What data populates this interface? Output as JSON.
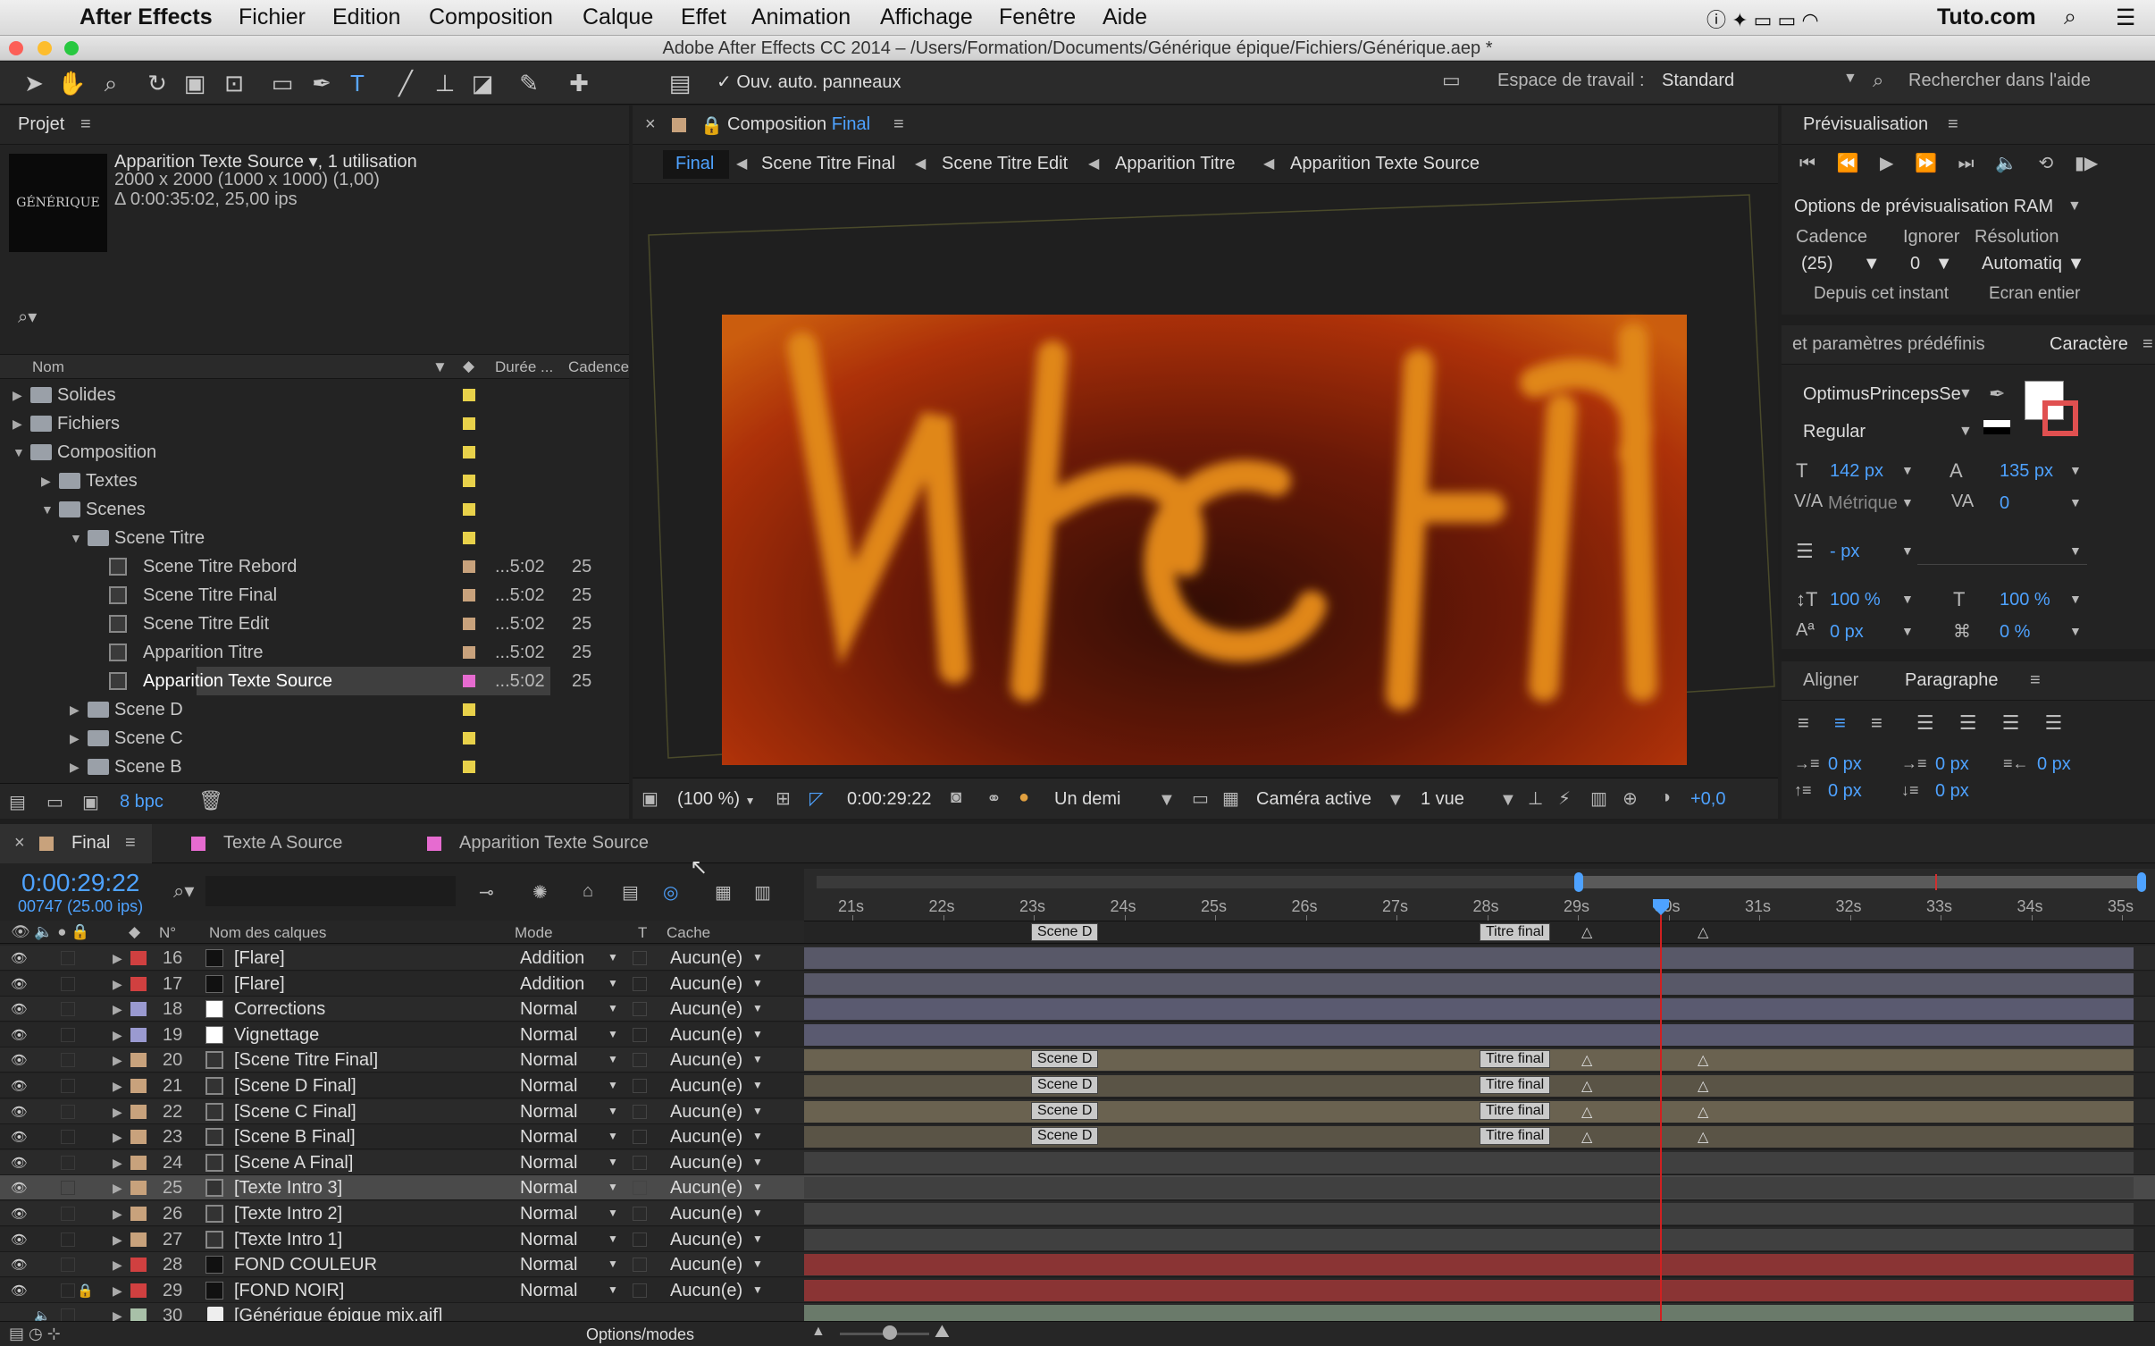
{
  "menubar": {
    "app": "After Effects",
    "items": [
      "Fichier",
      "Edition",
      "Composition",
      "Calque",
      "Effet",
      "Animation",
      "Affichage",
      "Fenêtre",
      "Aide"
    ],
    "right": "Tuto.com"
  },
  "window_title": "Adobe After Effects CC 2014 – /Users/Formation/Documents/Générique épique/Fichiers/Générique.aep *",
  "toolbar": {
    "auto_panels": "Ouv. auto. panneaux",
    "workspace_label": "Espace de travail :",
    "workspace_value": "Standard",
    "help_search": "Rechercher dans l'aide"
  },
  "project": {
    "tab": "Projet",
    "thumb_text": "GÉNÉRIQUE",
    "item_name": "Apparition Texte Source ▾",
    "item_usage": ", 1 utilisation",
    "item_size": "2000 x 2000  (1000 x 1000) (1,00)",
    "item_duration": "Δ 0:00:35:02, 25,00 ips",
    "col_name": "Nom",
    "col_duration": "Durée ...",
    "col_rate": "Cadence",
    "bpc": "8 bpc",
    "items": [
      {
        "name": "Solides",
        "indent": 0,
        "type": "folder",
        "open": false,
        "label_color": "#e8d14a",
        "dur": "",
        "rate": ""
      },
      {
        "name": "Fichiers",
        "indent": 0,
        "type": "folder",
        "open": false,
        "label_color": "#e8d14a",
        "dur": "",
        "rate": ""
      },
      {
        "name": "Composition",
        "indent": 0,
        "type": "folder",
        "open": true,
        "label_color": "#e8d14a",
        "dur": "",
        "rate": ""
      },
      {
        "name": "Textes",
        "indent": 1,
        "type": "folder",
        "open": false,
        "label_color": "#e8d14a",
        "dur": "",
        "rate": ""
      },
      {
        "name": "Scenes",
        "indent": 1,
        "type": "folder",
        "open": true,
        "label_color": "#e8d14a",
        "dur": "",
        "rate": ""
      },
      {
        "name": "Scene Titre",
        "indent": 2,
        "type": "folder",
        "open": true,
        "label_color": "#e8d14a",
        "dur": "",
        "rate": ""
      },
      {
        "name": "Scene Titre Rebord",
        "indent": 3,
        "type": "comp",
        "open": false,
        "label_color": "#c8a27c",
        "dur": "...5:02",
        "rate": "25"
      },
      {
        "name": "Scene Titre Final",
        "indent": 3,
        "type": "comp",
        "open": false,
        "label_color": "#c8a27c",
        "dur": "...5:02",
        "rate": "25"
      },
      {
        "name": "Scene Titre Edit",
        "indent": 3,
        "type": "comp",
        "open": false,
        "label_color": "#c8a27c",
        "dur": "...5:02",
        "rate": "25"
      },
      {
        "name": "Apparition Titre",
        "indent": 3,
        "type": "comp",
        "open": false,
        "label_color": "#c8a27c",
        "dur": "...5:02",
        "rate": "25"
      },
      {
        "name": "Apparition Texte Source",
        "indent": 3,
        "type": "comp",
        "open": false,
        "label_color": "#e66bd0",
        "dur": "...5:02",
        "rate": "25",
        "selected": true
      },
      {
        "name": "Scene D",
        "indent": 2,
        "type": "folder",
        "open": false,
        "label_color": "#e8d14a",
        "dur": "",
        "rate": ""
      },
      {
        "name": "Scene C",
        "indent": 2,
        "type": "folder",
        "open": false,
        "label_color": "#e8d14a",
        "dur": "",
        "rate": ""
      },
      {
        "name": "Scene B",
        "indent": 2,
        "type": "folder",
        "open": false,
        "label_color": "#e8d14a",
        "dur": "",
        "rate": ""
      }
    ]
  },
  "composition": {
    "tab_label": "Composition",
    "tab_name": "Final",
    "breadcrumbs": [
      "Final",
      "Scene Titre Final",
      "Scene Titre Edit",
      "Apparition Titre",
      "Apparition Texte Source"
    ],
    "zoom": "(100 %)",
    "timecode": "0:00:29:22",
    "resolution": "Un demi",
    "camera": "Caméra active",
    "views": "1 vue",
    "exposure": "+0,0"
  },
  "preview": {
    "tab": "Prévisualisation",
    "ram_options": "Options de prévisualisation RAM",
    "cadence_label": "Cadence",
    "ignore_label": "Ignorer",
    "resolution_label": "Résolution",
    "cadence_value": "(25)",
    "ignore_value": "0",
    "resolution_value": "Automatiq",
    "from_now": "Depuis cet instant",
    "fullscreen": "Ecran entier"
  },
  "character": {
    "tab_presets": "et paramètres prédéfinis",
    "tab": "Caractère",
    "font": "OptimusPrincepsSe",
    "style": "Regular",
    "size": "142 px",
    "leading": "135 px",
    "kerning": "Métrique",
    "tracking": "0",
    "stroke": "- px",
    "vscale": "100 %",
    "hscale": "100 %",
    "baseline": "0 px",
    "tsume": "0 %"
  },
  "paragraph": {
    "tab_align": "Aligner",
    "tab": "Paragraphe",
    "indent_left": "0 px",
    "indent_first": "0 px",
    "indent_right": "0 px",
    "space_before": "0 px",
    "space_after": "0 px"
  },
  "timeline": {
    "tabs": [
      {
        "name": "Final",
        "color": "#c8a27c",
        "active": true
      },
      {
        "name": "Texte A Source",
        "color": "#e66bd0"
      },
      {
        "name": "Apparition Texte Source",
        "color": "#e66bd0"
      }
    ],
    "timecode": "0:00:29:22",
    "frames": "00747 (25.00 ips)",
    "col_num": "N°",
    "col_name": "Nom des calques",
    "col_mode": "Mode",
    "col_t": "T",
    "col_cache": "Cache",
    "options_modes": "Options/modes",
    "ruler": [
      "21s",
      "22s",
      "23s",
      "24s",
      "25s",
      "26s",
      "27s",
      "28s",
      "29s",
      "30s",
      "31s",
      "32s",
      "33s",
      "34s",
      "35s"
    ],
    "top_markers": [
      "Scene D",
      "Titre final"
    ],
    "layers": [
      {
        "num": "16",
        "name": "[Flare]",
        "label": "#d04040",
        "swatch": "#111",
        "mode": "Addition",
        "cache": "Aucun(e)",
        "bar": "#585868",
        "eye": true
      },
      {
        "num": "17",
        "name": "[Flare]",
        "label": "#d04040",
        "swatch": "#111",
        "mode": "Addition",
        "cache": "Aucun(e)",
        "bar": "#585868",
        "eye": true
      },
      {
        "num": "18",
        "name": "Corrections",
        "label": "#9a9ad0",
        "swatch": "#fff",
        "mode": "Normal",
        "cache": "Aucun(e)",
        "bar": "#5a5a70",
        "eye": true
      },
      {
        "num": "19",
        "name": "Vignettage",
        "label": "#9a9ad0",
        "swatch": "#fff",
        "mode": "Normal",
        "cache": "Aucun(e)",
        "bar": "#5a5a70",
        "eye": true
      },
      {
        "num": "20",
        "name": "[Scene Titre Final]",
        "label": "#c8a27c",
        "swatch": "comp",
        "mode": "Normal",
        "cache": "Aucun(e)",
        "bar": "#6a6250",
        "eye": true,
        "markers": true
      },
      {
        "num": "21",
        "name": "[Scene D Final]",
        "label": "#c8a27c",
        "swatch": "comp",
        "mode": "Normal",
        "cache": "Aucun(e)",
        "bar": "#5a5446",
        "eye": true,
        "markers": true
      },
      {
        "num": "22",
        "name": "[Scene C Final]",
        "label": "#c8a27c",
        "swatch": "comp",
        "mode": "Normal",
        "cache": "Aucun(e)",
        "bar": "#6a6250",
        "eye": true,
        "markers": true
      },
      {
        "num": "23",
        "name": "[Scene B Final]",
        "label": "#c8a27c",
        "swatch": "comp",
        "mode": "Normal",
        "cache": "Aucun(e)",
        "bar": "#5a5446",
        "eye": true,
        "markers": true
      },
      {
        "num": "24",
        "name": "[Scene A Final]",
        "label": "#c8a27c",
        "swatch": "comp",
        "mode": "Normal",
        "cache": "Aucun(e)",
        "bar": "#404040",
        "eye": true
      },
      {
        "num": "25",
        "name": "[Texte Intro 3]",
        "label": "#c8a27c",
        "swatch": "comp",
        "mode": "Normal",
        "cache": "Aucun(e)",
        "bar": "#404040",
        "eye": true,
        "selected": true
      },
      {
        "num": "26",
        "name": "[Texte Intro 2]",
        "label": "#c8a27c",
        "swatch": "comp",
        "mode": "Normal",
        "cache": "Aucun(e)",
        "bar": "#404040",
        "eye": true
      },
      {
        "num": "27",
        "name": "[Texte Intro 1]",
        "label": "#c8a27c",
        "swatch": "comp",
        "mode": "Normal",
        "cache": "Aucun(e)",
        "bar": "#404040",
        "eye": true
      },
      {
        "num": "28",
        "name": "FOND COULEUR",
        "label": "#d04040",
        "swatch": "#111",
        "mode": "Normal",
        "cache": "Aucun(e)",
        "bar": "#8a3434",
        "eye": true
      },
      {
        "num": "29",
        "name": "[FOND NOIR]",
        "label": "#d04040",
        "swatch": "#111",
        "mode": "Normal",
        "cache": "Aucun(e)",
        "bar": "#8a3434",
        "eye": true,
        "lock": true
      },
      {
        "num": "30",
        "name": "[Générique épique mix.aif]",
        "label": "#a8c0a8",
        "swatch": "audio",
        "mode": "",
        "cache": "",
        "bar": "#6a7a6a",
        "eye": false,
        "audio": true
      }
    ]
  },
  "colors": {
    "accent": "#2d8ceb",
    "playhead": "#d02020",
    "selected_row": "#4a4a4a"
  },
  "icons": [
    "apple-icon",
    "search-icon",
    "wifi-icon",
    "play-icon",
    "eye-icon",
    "lock-icon",
    "folder-icon",
    "comp-icon",
    "trash-icon",
    "camera-icon"
  ]
}
